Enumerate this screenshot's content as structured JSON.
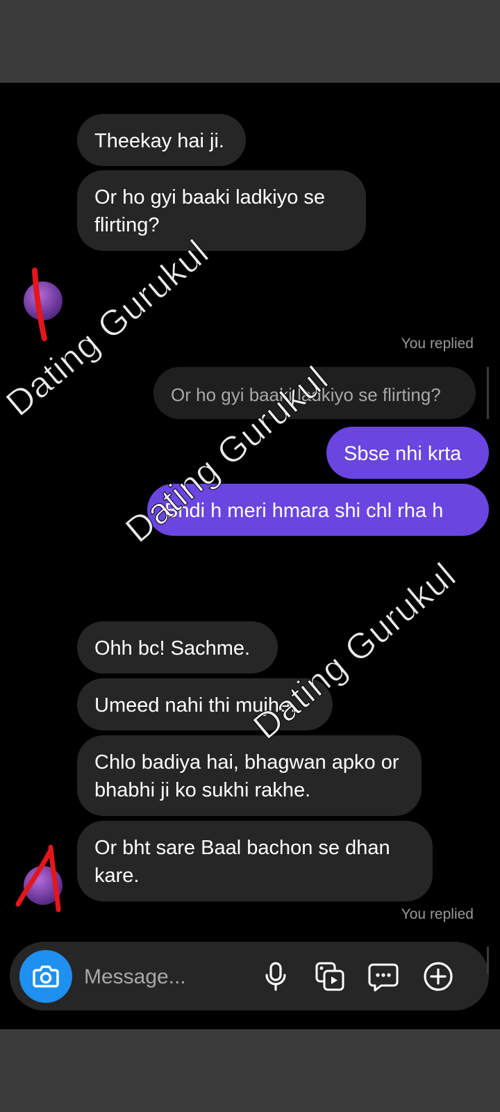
{
  "messages": {
    "m1": "Theekay hai ji.",
    "m2": "Or ho gyi baaki ladkiyo se flirting?",
    "m3_emoji": "😂",
    "reply_meta": "You replied",
    "reply_quote": "Or ho gyi baaki ladkiyo se flirting?",
    "s1": "Sbse nhi krta",
    "s2": "Bndi h meri hmara shi chl rha h",
    "s3_emoji": "😁😁😁",
    "m4": "Ohh bc! Sachme.",
    "m5": "Umeed nahi thi mujhe.",
    "m6": "Chlo badiya hai, bhagwan apko or bhabhi ji ko sukhi rakhe.",
    "m7": "Or bht sare Baal bachon se dhan kare.",
    "reply_meta_2": "You replied"
  },
  "watermark": "Dating Gurukul",
  "composer": {
    "placeholder": "Message...",
    "icons": [
      "camera-icon",
      "microphone-icon",
      "gallery-icon",
      "sticker-icon",
      "plus-icon"
    ]
  },
  "colors": {
    "incoming_bubble": "#262626",
    "outgoing_bubble": "#6a45e0",
    "camera_button": "#1e90f0",
    "background": "#000000"
  }
}
